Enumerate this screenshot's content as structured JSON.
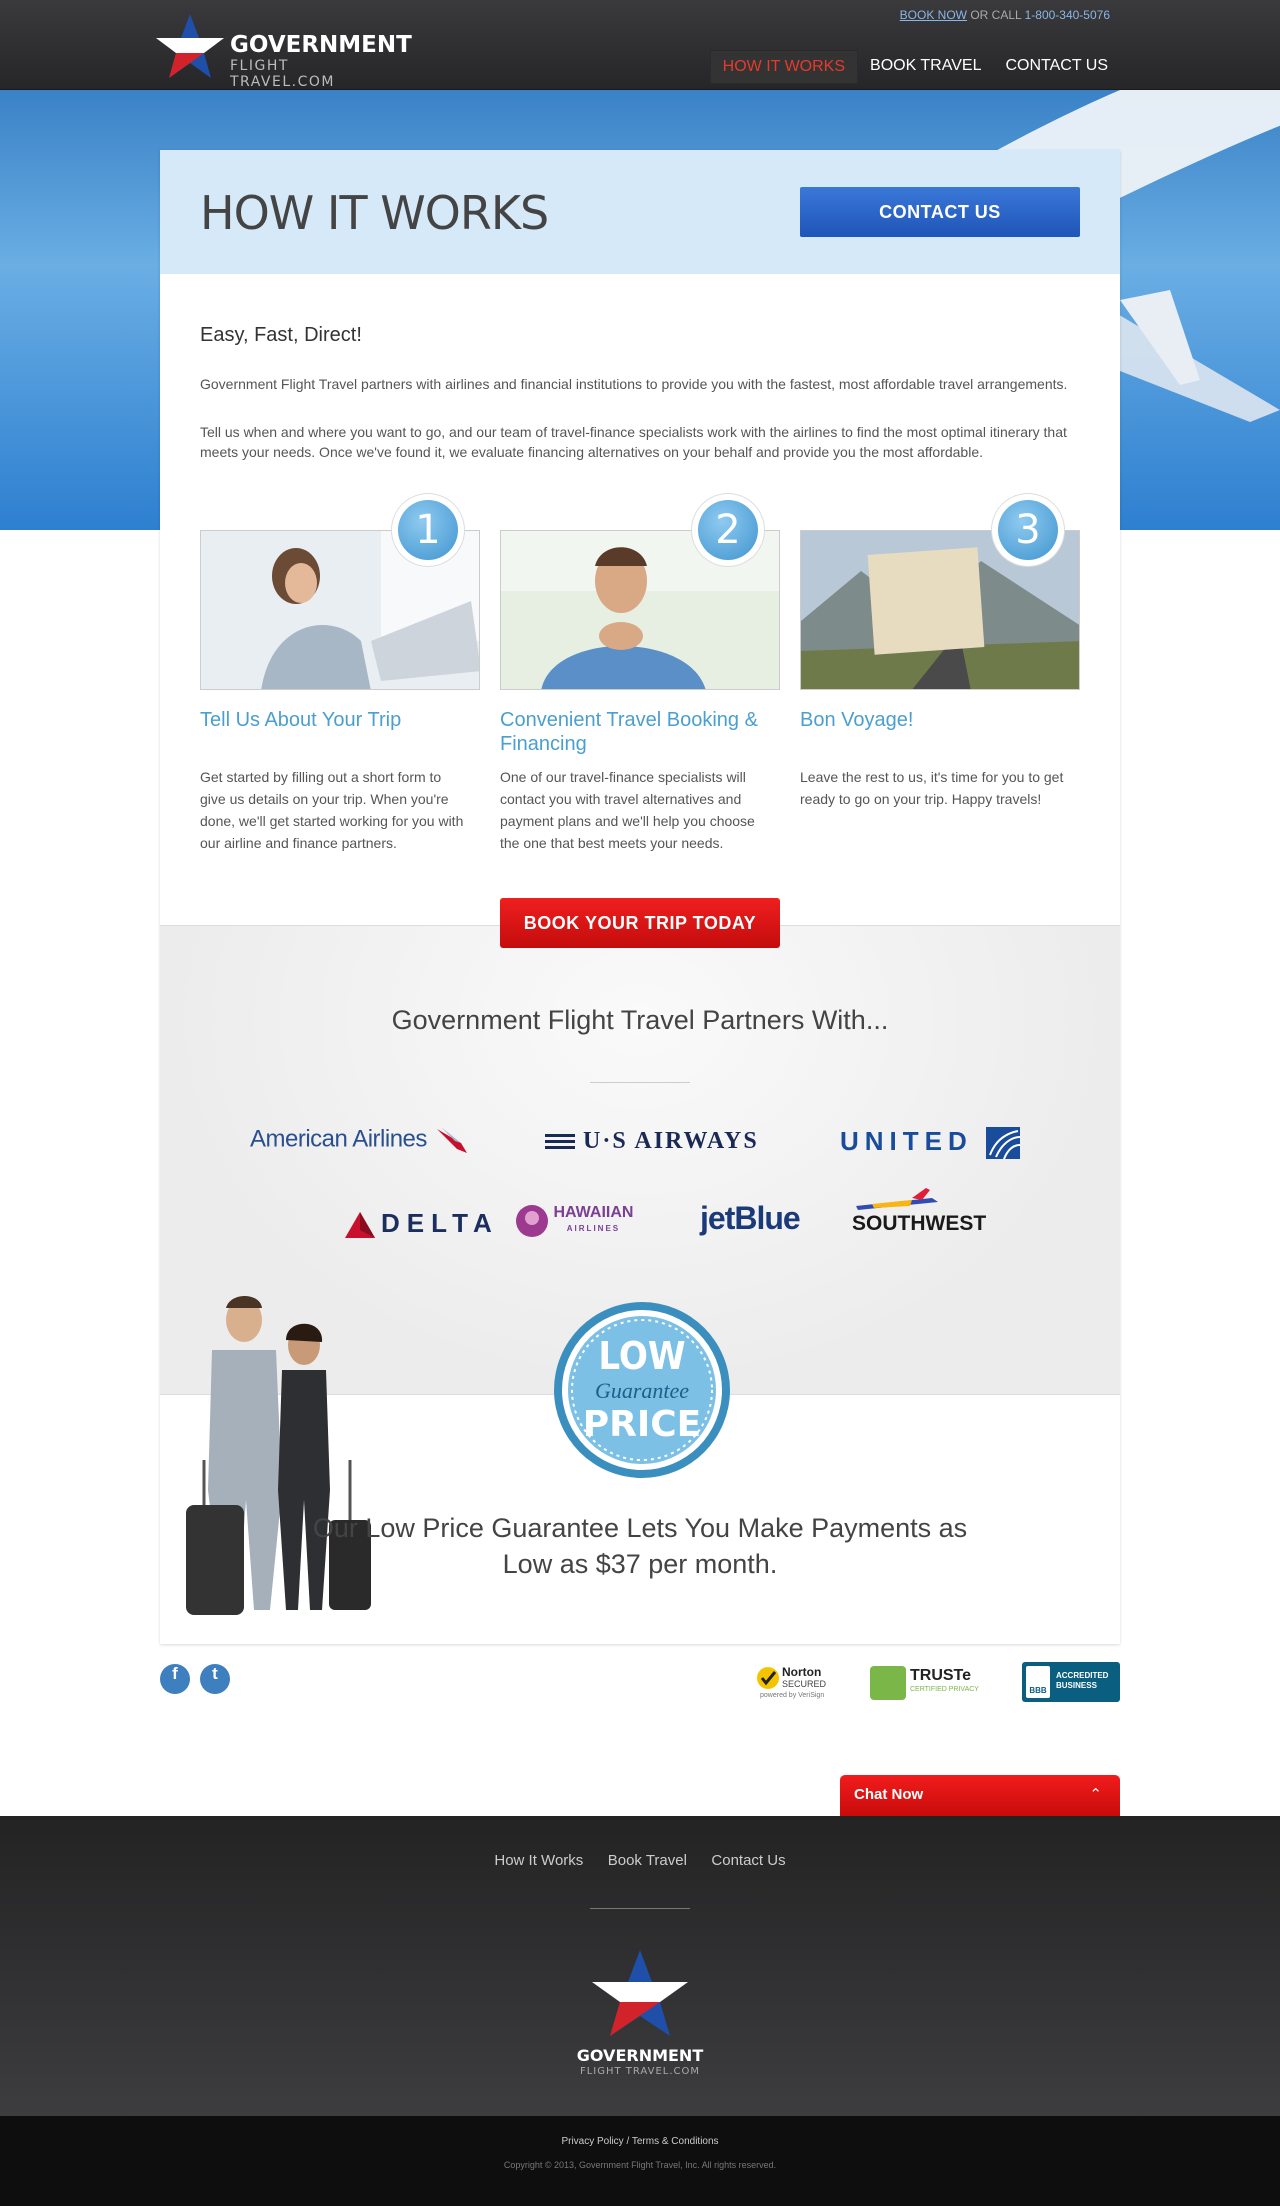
{
  "header": {
    "logo_line1": "GOVERNMENT",
    "logo_line2": "FLIGHT TRAVEL.COM",
    "book_now": "BOOK NOW",
    "or_call": " OR CALL ",
    "phone": "1-800-340-5076",
    "nav": [
      {
        "label": "HOW IT WORKS",
        "active": true
      },
      {
        "label": "BOOK TRAVEL",
        "active": false
      },
      {
        "label": "CONTACT US",
        "active": false
      }
    ]
  },
  "hero": {
    "title": "HOW IT WORKS",
    "contact_button": "CONTACT US"
  },
  "intro": {
    "heading": "Easy, Fast, Direct!",
    "p1": "Government Flight Travel partners with airlines and financial institutions to provide you with the fastest, most affordable travel arrangements.",
    "p2": "Tell us when and where you want to go, and our team of travel-finance specialists work with the airlines to find the most optimal itinerary that meets your needs. Once we've found it, we evaluate financing alternatives on your behalf and provide you the most affordable."
  },
  "steps": [
    {
      "number": "1",
      "title": "Tell Us About Your Trip",
      "text": "Get started by filling out a short form to give us details on your trip. When you're done, we'll get started working for you with our airline and finance partners."
    },
    {
      "number": "2",
      "title": "Convenient  Travel Booking & Financing",
      "text": "One of our travel-finance specialists will contact you with travel alternatives and payment plans and we'll help you choose the one that best meets your needs."
    },
    {
      "number": "3",
      "title": "Bon Voyage!",
      "text": "Leave the rest to us, it's time for you to get ready to go on your trip. Happy travels!"
    }
  ],
  "book_button": "BOOK YOUR TRIP TODAY",
  "partners": {
    "title": "Government Flight Travel Partners With...",
    "airlines": [
      "American Airlines",
      "U·S AIRWAYS",
      "UNITED",
      "DELTA",
      "HAWAIIAN",
      "AIRLINES",
      "jetBlue",
      "SOUTHWEST"
    ]
  },
  "badge": {
    "line1": "LOW",
    "line2": "Guarantee",
    "line3": "PRICE"
  },
  "promo": "Our Low Price Guarantee Lets You Make Payments as Low as $37 per month.",
  "social": {
    "facebook": "f",
    "twitter": "t"
  },
  "trust": {
    "norton": "Norton",
    "norton_sub": "SECURED",
    "norton_powered": "powered by VeriSign",
    "truste": "TRUSTe",
    "truste_sub": "CERTIFIED PRIVACY",
    "bbb": "ACCREDITED BUSINESS",
    "bbb_logo": "BBB"
  },
  "chat": {
    "label": "Chat Now",
    "icon": "chevron-up-icon"
  },
  "footer": {
    "nav": [
      "How It Works",
      "Book Travel",
      "Contact Us"
    ],
    "logo_line1": "GOVERNMENT",
    "logo_line2": "FLIGHT TRAVEL.COM",
    "privacy": "Privacy Policy",
    "separator": "/",
    "terms": "Terms & Conditions",
    "copyright": "Copyright © 2013, Government Flight Travel, Inc. All rights reserved."
  },
  "colors": {
    "accent_red": "#e0161a",
    "accent_blue": "#2a63c6",
    "step_blue": "#4a9fd0"
  }
}
